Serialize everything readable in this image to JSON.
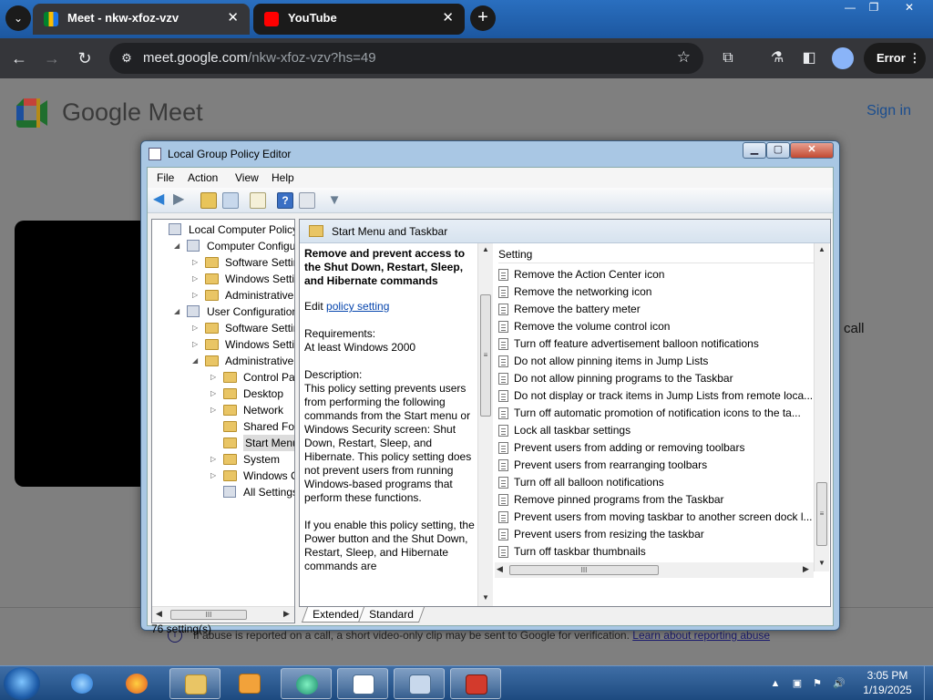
{
  "browser": {
    "tabs": [
      {
        "title": "Meet - nkw-xfoz-vzv",
        "active": true
      },
      {
        "title": "YouTube",
        "active": false
      }
    ],
    "tab_close": "✕",
    "new_tab": "+",
    "window_controls": {
      "minimize": "—",
      "restore": "❐",
      "close": "✕"
    },
    "url_host": "meet.google.com",
    "url_path": "/nkw-xfoz-vzv?hs=49",
    "error_label": "Error"
  },
  "meet": {
    "title": "Google Meet",
    "signin": "Sign in",
    "call_fragment": "call",
    "abuse_text": "If abuse is reported on a call, a short video-only clip may be sent to Google for verification.",
    "abuse_link": "Learn about reporting abuse"
  },
  "gpe": {
    "title": "Local Group Policy Editor",
    "menu": [
      "File",
      "Action",
      "View",
      "Help"
    ],
    "tree": [
      {
        "label": "Local Computer Policy",
        "level": 0,
        "arrow": "",
        "icon": "policy"
      },
      {
        "label": "Computer Configura",
        "level": 1,
        "arrow": "◢",
        "icon": "pc"
      },
      {
        "label": "Software Settings",
        "level": 2,
        "arrow": "▷",
        "icon": "folder"
      },
      {
        "label": "Windows Setting",
        "level": 2,
        "arrow": "▷",
        "icon": "folder"
      },
      {
        "label": "Administrative Te",
        "level": 2,
        "arrow": "▷",
        "icon": "folder"
      },
      {
        "label": "User Configuration",
        "level": 1,
        "arrow": "◢",
        "icon": "pc"
      },
      {
        "label": "Software Settings",
        "level": 2,
        "arrow": "▷",
        "icon": "folder"
      },
      {
        "label": "Windows Setting",
        "level": 2,
        "arrow": "▷",
        "icon": "folder"
      },
      {
        "label": "Administrative Te",
        "level": 2,
        "arrow": "◢",
        "icon": "folder"
      },
      {
        "label": "Control Panel",
        "level": 3,
        "arrow": "▷",
        "icon": "folder"
      },
      {
        "label": "Desktop",
        "level": 3,
        "arrow": "▷",
        "icon": "folder"
      },
      {
        "label": "Network",
        "level": 3,
        "arrow": "▷",
        "icon": "folder"
      },
      {
        "label": "Shared Folder",
        "level": 3,
        "arrow": "",
        "icon": "folder"
      },
      {
        "label": "Start Menu ar",
        "level": 3,
        "arrow": "",
        "icon": "folder",
        "selected": true
      },
      {
        "label": "System",
        "level": 3,
        "arrow": "▷",
        "icon": "folder"
      },
      {
        "label": "Windows Cor",
        "level": 3,
        "arrow": "▷",
        "icon": "folder"
      },
      {
        "label": "All Settings",
        "level": 3,
        "arrow": "",
        "icon": "settings"
      }
    ],
    "panel_title": "Start Menu and Taskbar",
    "policy_name": "Remove and prevent access to the Shut Down, Restart, Sleep, and Hibernate commands",
    "edit_prefix": "Edit",
    "edit_link": "policy setting",
    "requirements_label": "Requirements:",
    "requirements_value": "At least Windows 2000",
    "description_label": "Description:",
    "description_text": "This policy setting prevents users from performing the following commands from the Start menu or Windows Security screen: Shut Down, Restart, Sleep, and Hibernate. This policy setting does not prevent users from running Windows-based programs that perform these functions.",
    "enable_text": "If you enable this policy setting, the Power button and the Shut Down, Restart, Sleep, and Hibernate commands are",
    "column_header": "Setting",
    "settings": [
      "Remove the Action Center icon",
      "Remove the networking icon",
      "Remove the battery meter",
      "Remove the volume control icon",
      "Turn off feature advertisement balloon notifications",
      "Do not allow pinning items in Jump Lists",
      "Do not allow pinning programs to the Taskbar",
      "Do not display or track items in Jump Lists from remote loca...",
      "Turn off automatic promotion of notification icons to the ta...",
      "Lock all taskbar settings",
      "Prevent users from adding or removing toolbars",
      "Prevent users from rearranging toolbars",
      "Turn off all balloon notifications",
      "Remove pinned programs from the Taskbar",
      "Prevent users from moving taskbar to another screen dock l...",
      "Prevent users from resizing the taskbar",
      "Turn off taskbar thumbnails"
    ],
    "view_tabs": [
      "Extended",
      "Standard"
    ],
    "status": "76 setting(s)",
    "scroll_grip": "III",
    "scroll_grip_v": "≡"
  },
  "taskbar": {
    "time": "3:05 PM",
    "date": "1/19/2025"
  }
}
